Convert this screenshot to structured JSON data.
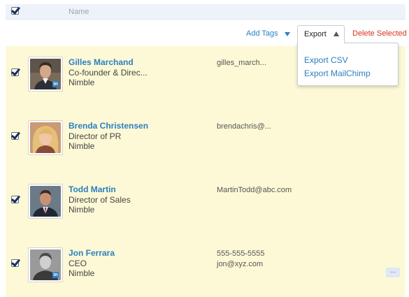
{
  "header": {
    "name_column": "Name"
  },
  "toolbar": {
    "add_tags_label": "Add Tags",
    "export_label": "Export",
    "delete_selected_label": "Delete Selected"
  },
  "export_menu": {
    "items": [
      "Export CSV",
      "Export MailChimp"
    ]
  },
  "contacts": [
    {
      "name": "Gilles Marchand",
      "title": "Co-founder & Direc...",
      "company": "Nimble",
      "contact_lines": [
        "gilles_march..."
      ],
      "linkedin": true,
      "checked": true
    },
    {
      "name": "Brenda Christensen",
      "title": "Director of PR",
      "company": "Nimble",
      "contact_lines": [
        "brendachris@..."
      ],
      "linkedin": false,
      "checked": true
    },
    {
      "name": "Todd Martin",
      "title": "Director of Sales",
      "company": "Nimble",
      "contact_lines": [
        "MartinTodd@abc.com"
      ],
      "linkedin": false,
      "checked": true
    },
    {
      "name": "Jon Ferrara",
      "title": "CEO",
      "company": "Nimble",
      "contact_lines": [
        "555-555-5555",
        "jon@xyz.com"
      ],
      "linkedin": true,
      "checked": true
    }
  ],
  "more_button_label": "...",
  "linkedin_badge": "in",
  "colors": {
    "link_blue": "#2a7fc1",
    "delete_red": "#d9301e",
    "row_highlight": "#fdf9d6",
    "header_bg": "#eef3fa"
  }
}
